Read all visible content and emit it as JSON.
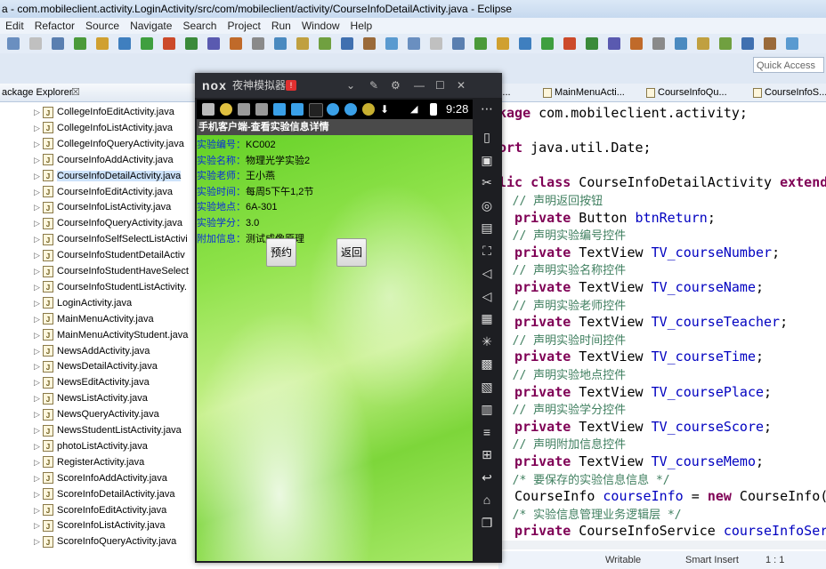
{
  "window": {
    "title": "a - com.mobileclient.activity.LoginActivity/src/com/mobileclient/activity/CourseInfoDetailActivity.java - Eclipse"
  },
  "menu": [
    "Edit",
    "Refactor",
    "Source",
    "Navigate",
    "Search",
    "Project",
    "Run",
    "Window",
    "Help"
  ],
  "quick_access": "Quick Access",
  "package_explorer": {
    "title": "ackage Explorer",
    "close": "☒",
    "files": [
      "CollegeInfoEditActivity.java",
      "CollegeInfoListActivity.java",
      "CollegeInfoQueryActivity.java",
      "CourseInfoAddActivity.java",
      "CourseInfoDetailActivity.java",
      "CourseInfoEditActivity.java",
      "CourseInfoListActivity.java",
      "CourseInfoQueryActivity.java",
      "CourseInfoSelfSelectListActivi",
      "CourseInfoStudentDetailActiv",
      "CourseInfoStudentHaveSelect",
      "CourseInfoStudentListActivity.",
      "LoginActivity.java",
      "MainMenuActivity.java",
      "MainMenuActivityStudent.java",
      "NewsAddActivity.java",
      "NewsDetailActivity.java",
      "NewsEditActivity.java",
      "NewsListActivity.java",
      "NewsQueryActivity.java",
      "NewsStudentListActivity.java",
      "photoListActivity.java",
      "RegisterActivity.java",
      "ScoreInfoAddActivity.java",
      "ScoreInfoDetailActivity.java",
      "ScoreInfoEditActivity.java",
      "ScoreInfoListActivity.java",
      "ScoreInfoQueryActivity.java"
    ]
  },
  "editor_tabs": [
    "nActivi...",
    "MainMenuActi...",
    "CourseInfoQu...",
    "CourseInfoS..."
  ],
  "code": [
    {
      "parts": [
        [
          "kw",
          "kage"
        ],
        [
          "type",
          " com.mobileclient.activity;"
        ]
      ]
    },
    {
      "parts": []
    },
    {
      "parts": [
        [
          "kw",
          "ort"
        ],
        [
          "type",
          " java.util.Date;"
        ]
      ]
    },
    {
      "parts": []
    },
    {
      "parts": [
        [
          "kw",
          "lic class"
        ],
        [
          "type",
          " CourseInfoDetailActivity "
        ],
        [
          "kw",
          "extend"
        ]
      ]
    },
    {
      "parts": [
        [
          "cmt",
          "  // 声明返回按钮"
        ]
      ]
    },
    {
      "parts": [
        [
          "kw",
          "  private"
        ],
        [
          "type",
          " Button "
        ],
        [
          "fld",
          "btnReturn"
        ],
        [
          "type",
          ";"
        ]
      ]
    },
    {
      "parts": [
        [
          "cmt",
          "  // 声明实验编号控件"
        ]
      ]
    },
    {
      "parts": [
        [
          "kw",
          "  private"
        ],
        [
          "type",
          " TextView "
        ],
        [
          "fld",
          "TV_courseNumber"
        ],
        [
          "type",
          ";"
        ]
      ]
    },
    {
      "parts": [
        [
          "cmt",
          "  // 声明实验名称控件"
        ]
      ]
    },
    {
      "parts": [
        [
          "kw",
          "  private"
        ],
        [
          "type",
          " TextView "
        ],
        [
          "fld",
          "TV_courseName"
        ],
        [
          "type",
          ";"
        ]
      ]
    },
    {
      "parts": [
        [
          "cmt",
          "  // 声明实验老师控件"
        ]
      ]
    },
    {
      "parts": [
        [
          "kw",
          "  private"
        ],
        [
          "type",
          " TextView "
        ],
        [
          "fld",
          "TV_courseTeacher"
        ],
        [
          "type",
          ";"
        ]
      ]
    },
    {
      "parts": [
        [
          "cmt",
          "  // 声明实验时间控件"
        ]
      ]
    },
    {
      "parts": [
        [
          "kw",
          "  private"
        ],
        [
          "type",
          " TextView "
        ],
        [
          "fld",
          "TV_courseTime"
        ],
        [
          "type",
          ";"
        ]
      ]
    },
    {
      "parts": [
        [
          "cmt",
          "  // 声明实验地点控件"
        ]
      ]
    },
    {
      "parts": [
        [
          "kw",
          "  private"
        ],
        [
          "type",
          " TextView "
        ],
        [
          "fld",
          "TV_coursePlace"
        ],
        [
          "type",
          ";"
        ]
      ]
    },
    {
      "parts": [
        [
          "cmt",
          "  // 声明实验学分控件"
        ]
      ]
    },
    {
      "parts": [
        [
          "kw",
          "  private"
        ],
        [
          "type",
          " TextView "
        ],
        [
          "fld",
          "TV_courseScore"
        ],
        [
          "type",
          ";"
        ]
      ]
    },
    {
      "parts": [
        [
          "cmt",
          "  // 声明附加信息控件"
        ]
      ]
    },
    {
      "parts": [
        [
          "kw",
          "  private"
        ],
        [
          "type",
          " TextView "
        ],
        [
          "fld",
          "TV_courseMemo"
        ],
        [
          "type",
          ";"
        ]
      ]
    },
    {
      "parts": [
        [
          "cmt",
          "  /* 要保存的实验信息信息 */"
        ]
      ]
    },
    {
      "parts": [
        [
          "type",
          "  CourseInfo "
        ],
        [
          "fld",
          "courseInfo"
        ],
        [
          "type",
          " = "
        ],
        [
          "kw",
          "new"
        ],
        [
          "type",
          " CourseInfo()"
        ]
      ]
    },
    {
      "parts": [
        [
          "cmt",
          "  /* 实验信息管理业务逻辑层 */"
        ]
      ]
    },
    {
      "parts": [
        [
          "kw",
          "  private"
        ],
        [
          "type",
          " CourseInfoService "
        ],
        [
          "fld",
          "courseInfoServ"
        ]
      ]
    }
  ],
  "status": {
    "writable": "Writable",
    "insert": "Smart Insert",
    "pos": "1 : 1"
  },
  "emulator": {
    "logo": "nox",
    "name": "夜神模拟器",
    "badge": "!",
    "time": "9:28",
    "app_title": "手机客户端-查看实验信息详情",
    "fields": [
      {
        "label": "实验编号：",
        "value": "KC002"
      },
      {
        "label": "实验名称：",
        "value": "物理光学实验2"
      },
      {
        "label": "实验老师：",
        "value": "王小燕"
      },
      {
        "label": "实验时间：",
        "value": "每周5下午1,2节"
      },
      {
        "label": "实验地点：",
        "value": "6A-301"
      },
      {
        "label": "实验学分：",
        "value": "3.0"
      },
      {
        "label": "附加信息：",
        "value": "测试成像原理"
      }
    ],
    "reserve_label": "预约",
    "return_label": "返回"
  },
  "colors": {
    "keyword": "#7f0055",
    "field": "#0000c0",
    "comment": "#3f7f5f"
  }
}
